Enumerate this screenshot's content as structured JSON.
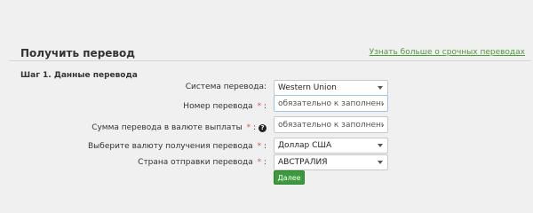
{
  "header": {
    "title": "Получить перевод",
    "learn_more_link": "Узнать больше о срочных переводах"
  },
  "step": {
    "heading": "Шаг 1. Данные перевода"
  },
  "form": {
    "system": {
      "label": "Система перевода:",
      "value": "Western Union"
    },
    "number": {
      "label": "Номер перевода",
      "required": "*",
      "colon": ":",
      "placeholder": "обязательно к заполнению"
    },
    "amount": {
      "label": "Сумма перевода в валюте выплаты",
      "required": "*",
      "colon": ":",
      "help": "?",
      "placeholder": "обязательно к заполнению"
    },
    "currency": {
      "label": "Выберите валюту получения перевода",
      "required": "*",
      "colon": ":",
      "value": "Доллар США"
    },
    "country": {
      "label": "Страна отправки перевода",
      "required": "*",
      "colon": ":",
      "value": "АВСТРАЛИЯ"
    },
    "submit_label": "Далее"
  }
}
